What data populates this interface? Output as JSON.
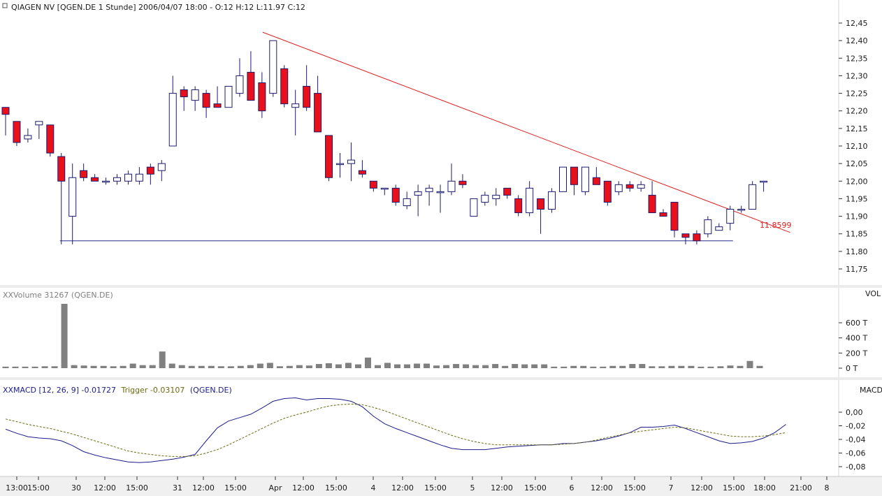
{
  "main_panel": {
    "title": "QIAGEN NV [QGEN.DE  1 Stunde] 2006/04/07 18:00 - O:12 H:12 L:11.97 C:12",
    "y_ticks": [
      "12,45",
      "12,40",
      "12,35",
      "12,30",
      "12,25",
      "12,20",
      "12,15",
      "12,10",
      "12,05",
      "12,00",
      "11,95",
      "11,90",
      "11,85",
      "11,80",
      "11,75"
    ],
    "trendline_label": "11.8599"
  },
  "volume_panel": {
    "title": "Volume 31267 (QGEN.DE)",
    "right_label": "VOL",
    "y_ticks": [
      "600 T",
      "400 T",
      "200 T",
      "0 T"
    ]
  },
  "macd_panel": {
    "title": "MACD [12, 26, 9] -0.01727",
    "trigger_label": "Trigger -0.03107",
    "symbol_label": "(QGEN.DE)",
    "right_label": "MACD",
    "y_ticks": [
      "0,00",
      "-0,02",
      "-0,04",
      "-0,06",
      "-0,08"
    ]
  },
  "x_ticks": [
    "13:00",
    "15:00",
    "30",
    "12:00",
    "15:00",
    "31",
    "12:00",
    "15:00",
    "Apr",
    "12:00",
    "15:00",
    "4",
    "12:00",
    "15:00",
    "5",
    "12:00",
    "15:00",
    "6",
    "12:00",
    "15:00",
    "7",
    "12:00",
    "15:00",
    "18:00",
    "21:00",
    "8"
  ],
  "colors": {
    "bearish": "#e8101a",
    "bullish": "#ffffff",
    "candle_outline": "#1c1c6e",
    "trend_down": "#e02020",
    "support": "#2a2a8a",
    "volume": "#808080",
    "macd_line": "#1c1c8c",
    "trigger_line": "#6b6b10"
  },
  "chart_data": [
    {
      "type": "candlestick",
      "title": "QIAGEN NV [QGEN.DE  1 Stunde] 2006/04/07 18:00 - O:12 H:12 L:11.97 C:12",
      "ylim": [
        11.72,
        12.48
      ],
      "grid": false,
      "candles": [
        {
          "o": 12.21,
          "h": 12.21,
          "l": 12.13,
          "c": 12.19
        },
        {
          "o": 12.17,
          "h": 12.17,
          "l": 12.1,
          "c": 12.11
        },
        {
          "o": 12.12,
          "h": 12.15,
          "l": 12.11,
          "c": 12.13
        },
        {
          "o": 12.16,
          "h": 12.17,
          "l": 12.12,
          "c": 12.17
        },
        {
          "o": 12.16,
          "h": 12.16,
          "l": 12.07,
          "c": 12.08
        },
        {
          "o": 12.07,
          "h": 12.08,
          "l": 11.82,
          "c": 12.0
        },
        {
          "o": 11.9,
          "h": 12.05,
          "l": 11.82,
          "c": 12.01
        },
        {
          "o": 12.03,
          "h": 12.05,
          "l": 12.0,
          "c": 12.01
        },
        {
          "o": 12.01,
          "h": 12.02,
          "l": 12.0,
          "c": 12.0
        },
        {
          "o": 12.0,
          "h": 12.01,
          "l": 11.99,
          "c": 12.0
        },
        {
          "o": 12.0,
          "h": 12.02,
          "l": 11.99,
          "c": 12.01
        },
        {
          "o": 12.0,
          "h": 12.03,
          "l": 11.99,
          "c": 12.02
        },
        {
          "o": 12.0,
          "h": 12.04,
          "l": 11.99,
          "c": 12.02
        },
        {
          "o": 12.04,
          "h": 12.05,
          "l": 11.99,
          "c": 12.02
        },
        {
          "o": 12.03,
          "h": 12.06,
          "l": 12.0,
          "c": 12.05
        },
        {
          "o": 12.1,
          "h": 12.3,
          "l": 12.1,
          "c": 12.25
        },
        {
          "o": 12.26,
          "h": 12.27,
          "l": 12.2,
          "c": 12.24
        },
        {
          "o": 12.23,
          "h": 12.27,
          "l": 12.2,
          "c": 12.26
        },
        {
          "o": 12.25,
          "h": 12.26,
          "l": 12.18,
          "c": 12.21
        },
        {
          "o": 12.22,
          "h": 12.27,
          "l": 12.21,
          "c": 12.21
        },
        {
          "o": 12.21,
          "h": 12.27,
          "l": 12.21,
          "c": 12.27
        },
        {
          "o": 12.25,
          "h": 12.35,
          "l": 12.24,
          "c": 12.3
        },
        {
          "o": 12.31,
          "h": 12.37,
          "l": 12.23,
          "c": 12.23
        },
        {
          "o": 12.28,
          "h": 12.31,
          "l": 12.18,
          "c": 12.2
        },
        {
          "o": 12.25,
          "h": 12.4,
          "l": 12.24,
          "c": 12.4
        },
        {
          "o": 12.32,
          "h": 12.33,
          "l": 12.21,
          "c": 12.22
        },
        {
          "o": 12.21,
          "h": 12.26,
          "l": 12.13,
          "c": 12.22
        },
        {
          "o": 12.27,
          "h": 12.33,
          "l": 12.2,
          "c": 12.21
        },
        {
          "o": 12.25,
          "h": 12.3,
          "l": 12.14,
          "c": 12.14
        },
        {
          "o": 12.13,
          "h": 12.13,
          "l": 12.0,
          "c": 12.01
        },
        {
          "o": 12.05,
          "h": 12.08,
          "l": 12.01,
          "c": 12.05
        },
        {
          "o": 12.05,
          "h": 12.11,
          "l": 12.0,
          "c": 12.06
        },
        {
          "o": 12.03,
          "h": 12.06,
          "l": 12.01,
          "c": 12.02
        },
        {
          "o": 12.0,
          "h": 12.0,
          "l": 11.97,
          "c": 11.98
        },
        {
          "o": 11.98,
          "h": 11.98,
          "l": 11.96,
          "c": 11.98
        },
        {
          "o": 11.98,
          "h": 11.99,
          "l": 11.93,
          "c": 11.94
        },
        {
          "o": 11.93,
          "h": 11.97,
          "l": 11.92,
          "c": 11.95
        },
        {
          "o": 11.96,
          "h": 11.99,
          "l": 11.9,
          "c": 11.97
        },
        {
          "o": 11.97,
          "h": 11.99,
          "l": 11.93,
          "c": 11.98
        },
        {
          "o": 11.97,
          "h": 11.99,
          "l": 11.91,
          "c": 11.97
        },
        {
          "o": 11.97,
          "h": 12.05,
          "l": 11.96,
          "c": 12.0
        },
        {
          "o": 12.0,
          "h": 12.02,
          "l": 11.98,
          "c": 11.99
        },
        {
          "o": 11.9,
          "h": 11.95,
          "l": 11.9,
          "c": 11.95
        },
        {
          "o": 11.94,
          "h": 11.97,
          "l": 11.93,
          "c": 11.96
        },
        {
          "o": 11.95,
          "h": 11.98,
          "l": 11.93,
          "c": 11.96
        },
        {
          "o": 11.98,
          "h": 11.98,
          "l": 11.95,
          "c": 11.96
        },
        {
          "o": 11.95,
          "h": 11.96,
          "l": 11.9,
          "c": 11.91
        },
        {
          "o": 11.91,
          "h": 12.0,
          "l": 11.9,
          "c": 11.98
        },
        {
          "o": 11.95,
          "h": 11.95,
          "l": 11.85,
          "c": 11.92
        },
        {
          "o": 11.92,
          "h": 11.98,
          "l": 11.91,
          "c": 11.97
        },
        {
          "o": 11.97,
          "h": 12.04,
          "l": 11.97,
          "c": 12.04
        },
        {
          "o": 12.04,
          "h": 12.04,
          "l": 11.96,
          "c": 11.99
        },
        {
          "o": 11.97,
          "h": 12.04,
          "l": 11.96,
          "c": 12.04
        },
        {
          "o": 12.01,
          "h": 12.04,
          "l": 11.99,
          "c": 11.99
        },
        {
          "o": 12.0,
          "h": 12.0,
          "l": 11.93,
          "c": 11.94
        },
        {
          "o": 11.97,
          "h": 12.0,
          "l": 11.96,
          "c": 11.99
        },
        {
          "o": 11.99,
          "h": 12.0,
          "l": 11.97,
          "c": 11.98
        },
        {
          "o": 11.98,
          "h": 12.0,
          "l": 11.97,
          "c": 11.99
        },
        {
          "o": 11.96,
          "h": 12.0,
          "l": 11.91,
          "c": 11.91
        },
        {
          "o": 11.91,
          "h": 11.92,
          "l": 11.9,
          "c": 11.9
        },
        {
          "o": 11.94,
          "h": 11.94,
          "l": 11.84,
          "c": 11.86
        },
        {
          "o": 11.85,
          "h": 11.85,
          "l": 11.82,
          "c": 11.84
        },
        {
          "o": 11.85,
          "h": 11.86,
          "l": 11.82,
          "c": 11.83
        },
        {
          "o": 11.85,
          "h": 11.9,
          "l": 11.84,
          "c": 11.89
        },
        {
          "o": 11.86,
          "h": 11.88,
          "l": 11.86,
          "c": 11.87
        },
        {
          "o": 11.88,
          "h": 11.93,
          "l": 11.86,
          "c": 11.92
        },
        {
          "o": 11.92,
          "h": 11.93,
          "l": 11.91,
          "c": 11.92
        },
        {
          "o": 11.92,
          "h": 12.0,
          "l": 11.92,
          "c": 11.99
        },
        {
          "o": 12.0,
          "h": 12.0,
          "l": 11.97,
          "c": 12.0
        }
      ],
      "annotations": [
        {
          "type": "trendline",
          "from_candle": 24,
          "from_price": 12.41,
          "to_candle": 70,
          "to_price": 11.86,
          "label": "11.8599"
        },
        {
          "type": "horizontal",
          "from_candle": 5,
          "to_candle": 65,
          "price": 11.83
        }
      ]
    },
    {
      "type": "bar",
      "title": "Volume 31267 (QGEN.DE)",
      "ylabel": "VOL",
      "ylim": [
        0,
        800
      ],
      "unit": "T",
      "values": [
        20,
        20,
        20,
        20,
        25,
        25,
        850,
        40,
        35,
        30,
        30,
        25,
        30,
        60,
        40,
        40,
        220,
        60,
        40,
        30,
        30,
        30,
        25,
        25,
        30,
        40,
        60,
        70,
        25,
        30,
        40,
        35,
        55,
        65,
        50,
        70,
        50,
        140,
        40,
        70,
        50,
        50,
        60,
        60,
        35,
        40,
        55,
        50,
        40,
        40,
        55,
        30,
        55,
        50,
        50,
        50,
        20,
        20,
        30,
        30,
        20,
        20,
        30,
        30,
        55,
        55,
        25,
        25,
        30,
        30,
        30,
        20,
        20,
        25,
        35,
        30,
        95,
        30
      ]
    },
    {
      "type": "line",
      "title": "MACD [12, 26, 9] -0.01727",
      "ylabel": "MACD",
      "ylim": [
        -0.09,
        0.01
      ],
      "series": [
        {
          "name": "MACD [12, 26, 9] -0.01727",
          "x": [
            0,
            1,
            2,
            3,
            4,
            5,
            6,
            7,
            8,
            9,
            10,
            11,
            12,
            13,
            14,
            15,
            16,
            17,
            18,
            19,
            20,
            21,
            22,
            23,
            24,
            25,
            26,
            27,
            28,
            29,
            30,
            31,
            32,
            33,
            34,
            35,
            36,
            37,
            38,
            39,
            40,
            41,
            42,
            43,
            44,
            45,
            46,
            47,
            48,
            49,
            50,
            51,
            52,
            53,
            54,
            55,
            56,
            57,
            58,
            59,
            60,
            61,
            62,
            63,
            64,
            65,
            66,
            67,
            68,
            69,
            70
          ],
          "values": [
            -0.025,
            -0.031,
            -0.036,
            -0.038,
            -0.039,
            -0.042,
            -0.049,
            -0.058,
            -0.063,
            -0.067,
            -0.07,
            -0.073,
            -0.074,
            -0.073,
            -0.071,
            -0.069,
            -0.066,
            -0.062,
            -0.042,
            -0.023,
            -0.013,
            -0.008,
            -0.003,
            0.006,
            0.016,
            0.02,
            0.021,
            0.018,
            0.02,
            0.02,
            0.019,
            0.016,
            0.008,
            -0.006,
            -0.017,
            -0.024,
            -0.03,
            -0.036,
            -0.042,
            -0.048,
            -0.053,
            -0.055,
            -0.055,
            -0.055,
            -0.053,
            -0.051,
            -0.05,
            -0.049,
            -0.048,
            -0.048,
            -0.046,
            -0.046,
            -0.044,
            -0.042,
            -0.039,
            -0.035,
            -0.03,
            -0.022,
            -0.022,
            -0.021,
            -0.019,
            -0.024,
            -0.03,
            -0.036,
            -0.042,
            -0.046,
            -0.045,
            -0.043,
            -0.038,
            -0.03,
            -0.018
          ]
        },
        {
          "name": "Trigger -0.03107",
          "x": [
            0,
            1,
            2,
            3,
            4,
            5,
            6,
            7,
            8,
            9,
            10,
            11,
            12,
            13,
            14,
            15,
            16,
            17,
            18,
            19,
            20,
            21,
            22,
            23,
            24,
            25,
            26,
            27,
            28,
            29,
            30,
            31,
            32,
            33,
            34,
            35,
            36,
            37,
            38,
            39,
            40,
            41,
            42,
            43,
            44,
            45,
            46,
            47,
            48,
            49,
            50,
            51,
            52,
            53,
            54,
            55,
            56,
            57,
            58,
            59,
            60,
            61,
            62,
            63,
            64,
            65,
            66,
            67,
            68,
            69,
            70
          ],
          "values": [
            -0.01,
            -0.014,
            -0.018,
            -0.021,
            -0.024,
            -0.028,
            -0.032,
            -0.037,
            -0.042,
            -0.047,
            -0.052,
            -0.057,
            -0.06,
            -0.062,
            -0.064,
            -0.065,
            -0.065,
            -0.064,
            -0.06,
            -0.055,
            -0.048,
            -0.04,
            -0.032,
            -0.024,
            -0.016,
            -0.009,
            -0.004,
            0.0,
            0.005,
            0.009,
            0.011,
            0.012,
            0.011,
            0.007,
            0.002,
            -0.004,
            -0.01,
            -0.016,
            -0.022,
            -0.028,
            -0.034,
            -0.039,
            -0.043,
            -0.046,
            -0.048,
            -0.048,
            -0.048,
            -0.048,
            -0.048,
            -0.048,
            -0.047,
            -0.046,
            -0.044,
            -0.041,
            -0.037,
            -0.034,
            -0.03,
            -0.028,
            -0.026,
            -0.024,
            -0.022,
            -0.023,
            -0.026,
            -0.029,
            -0.032,
            -0.035,
            -0.036,
            -0.036,
            -0.035,
            -0.033,
            -0.03
          ]
        }
      ]
    }
  ]
}
